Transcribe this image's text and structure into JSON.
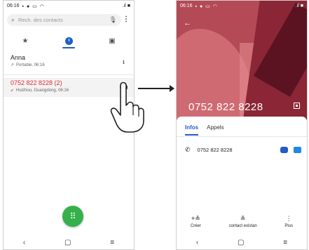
{
  "left_phone": {
    "status": {
      "time": "06:16",
      "right": ".ıl ■"
    },
    "search": {
      "placeholder": "Rech. des contacts"
    },
    "tabs": [
      {
        "icon": "star-icon",
        "glyph": "★"
      },
      {
        "icon": "clock-icon",
        "glyph": ""
      },
      {
        "icon": "contacts-icon",
        "glyph": "▣"
      }
    ],
    "calls": [
      {
        "name": "Anna",
        "sub": "Portable, 06:16"
      },
      {
        "name": "0752 822 8228 (2)",
        "sub": "Huizhou, Guangdong, 06:16"
      }
    ],
    "info_glyph": "i",
    "fab_glyph": "⠿",
    "nav": [
      "‹",
      "▢",
      "≡"
    ]
  },
  "right_phone": {
    "status": {
      "time": "06:16",
      "right": ".ıl ■"
    },
    "number": "0752 822 8228",
    "tabs": [
      "Infos",
      "Appels"
    ],
    "phone_line": "0752 822 8228",
    "actions": [
      {
        "label": "Créer",
        "glyph": "+≗"
      },
      {
        "label": "contact existan",
        "glyph": "≗"
      },
      {
        "label": "Plus",
        "glyph": "⋮"
      }
    ],
    "nav": [
      "‹",
      "▢",
      "≡"
    ]
  }
}
